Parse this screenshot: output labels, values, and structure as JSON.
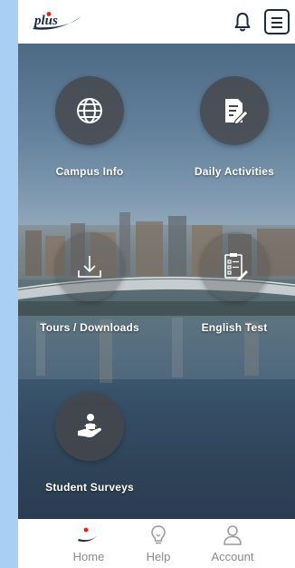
{
  "header": {
    "logo_text": "plus",
    "icons": [
      "bell-icon",
      "menu-icon"
    ]
  },
  "tiles": [
    {
      "label": "Campus Info",
      "icon": "globe-icon"
    },
    {
      "label": "Daily Activities",
      "icon": "edit-document-icon"
    },
    {
      "label": "Tours / Downloads",
      "icon": "download-icon"
    },
    {
      "label": "English Test",
      "icon": "test-sheet-icon"
    },
    {
      "label": "Student Surveys",
      "icon": "survey-hand-icon"
    }
  ],
  "bottom_nav": [
    {
      "label": "Home",
      "icon": "plus-swoosh-icon",
      "active": true
    },
    {
      "label": "Help",
      "icon": "lightbulb-icon",
      "active": false
    },
    {
      "label": "Account",
      "icon": "user-icon",
      "active": false
    }
  ],
  "colors": {
    "background": "#a9cff3",
    "brand_navy": "#1c2a44",
    "brand_red": "#e2231a",
    "tile_circle": "#46464a",
    "nav_text": "#8a8a8a"
  }
}
